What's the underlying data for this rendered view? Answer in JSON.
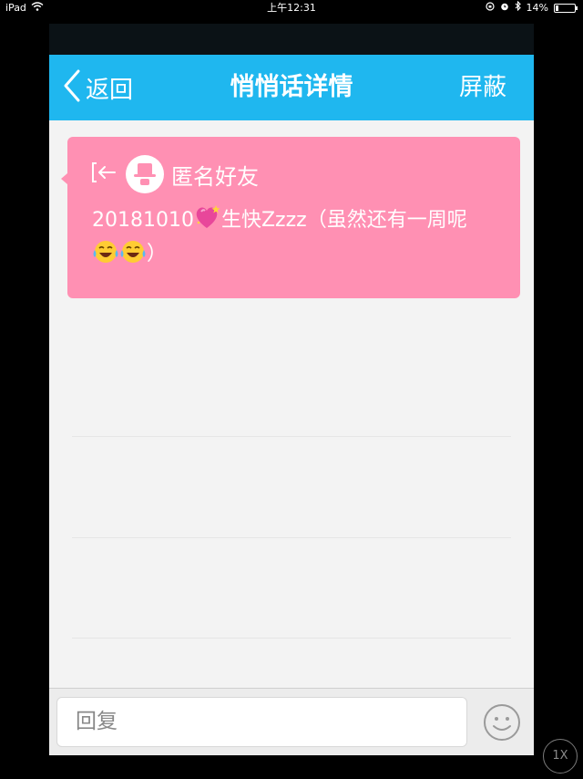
{
  "status_bar": {
    "device": "iPad",
    "time": "上午12:31",
    "battery_percent": "14%",
    "battery_level": 0.14
  },
  "nav": {
    "back_label": "返回",
    "title": "悄悄话详情",
    "right_action": "屏蔽"
  },
  "message": {
    "sender": "匿名好友",
    "text_part1": "20181010",
    "text_part2": "生快Zzzz（虽然还有一周呢",
    "text_part3": "）",
    "emojis": [
      "sparkling-heart",
      "face-with-tears-of-joy",
      "face-with-tears-of-joy"
    ]
  },
  "reply": {
    "placeholder": "回复"
  },
  "zoom_badge": "1X",
  "colors": {
    "nav_bg": "#1fb7ef",
    "bubble_bg": "#ff90b3",
    "page_bg": "#f3f3f3"
  }
}
